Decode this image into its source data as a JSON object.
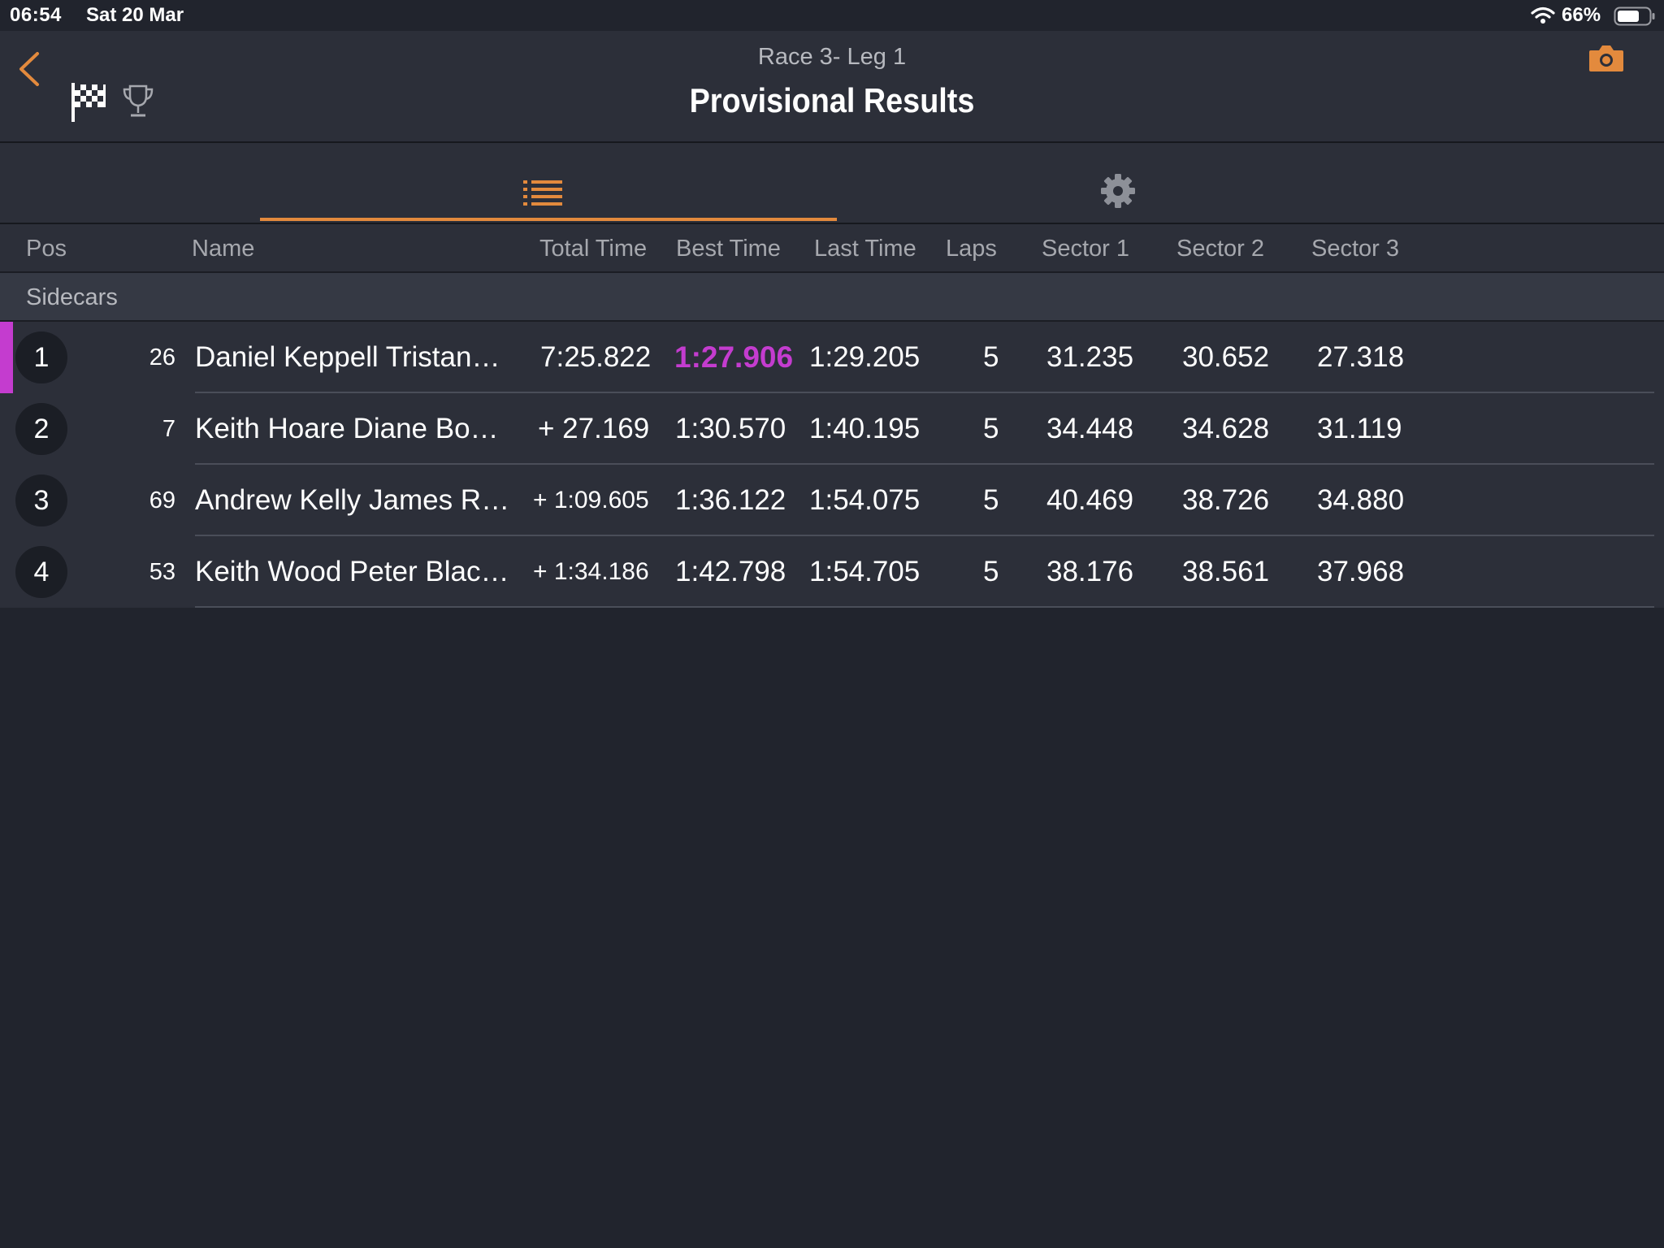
{
  "status_bar": {
    "time": "06:54",
    "date": "Sat 20 Mar",
    "battery": "66%"
  },
  "header": {
    "subtitle": "Race 3-  Leg 1",
    "title": "Provisional Results"
  },
  "colors": {
    "accent": "#e38a3d",
    "best_lap": "#c43ccf",
    "background": "#21242d"
  },
  "icons": [
    "back-chevron-icon",
    "checkered-flag-icon",
    "trophy-icon",
    "camera-icon",
    "list-icon",
    "gear-icon",
    "wifi-icon",
    "battery-icon"
  ],
  "columns": {
    "pos": "Pos",
    "name": "Name",
    "total": "Total Time",
    "best": "Best Time",
    "last": "Last Time",
    "laps": "Laps",
    "s1": "Sector 1",
    "s2": "Sector 2",
    "s3": "Sector 3"
  },
  "group": "Sidecars",
  "rows": [
    {
      "pos": "1",
      "number": "26",
      "name": "Daniel Keppell Tristan…",
      "total": "7:25.822",
      "best": "1:27.906",
      "last": "1:29.205",
      "laps": "5",
      "s1": "31.235",
      "s2": "30.652",
      "s3": "27.318"
    },
    {
      "pos": "2",
      "number": "7",
      "name": "Keith Hoare Diane Bo…",
      "total": "+ 27.169",
      "best": "1:30.570",
      "last": "1:40.195",
      "laps": "5",
      "s1": "34.448",
      "s2": "34.628",
      "s3": "31.119"
    },
    {
      "pos": "3",
      "number": "69",
      "name": "Andrew Kelly James R…",
      "total": "+ 1:09.605",
      "best": "1:36.122",
      "last": "1:54.075",
      "laps": "5",
      "s1": "40.469",
      "s2": "38.726",
      "s3": "34.880"
    },
    {
      "pos": "4",
      "number": "53",
      "name": "Keith Wood Peter Blac…",
      "total": "+ 1:34.186",
      "best": "1:42.798",
      "last": "1:54.705",
      "laps": "5",
      "s1": "38.176",
      "s2": "38.561",
      "s3": "37.968"
    }
  ]
}
